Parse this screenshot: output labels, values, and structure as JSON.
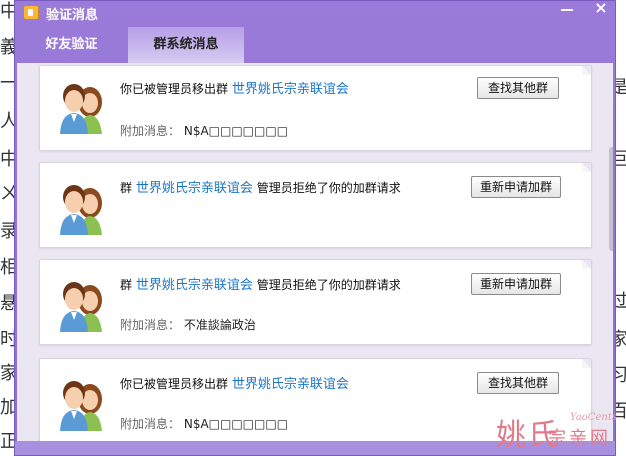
{
  "background": {
    "left_chars": [
      "中",
      "義",
      "一",
      "人",
      "中",
      "ㄨ",
      "录",
      "相",
      "悬",
      "时",
      "家",
      "加",
      "正"
    ],
    "right_chars": [
      "、",
      "是",
      "巨",
      "、",
      "过",
      "家",
      "习",
      "百"
    ]
  },
  "window": {
    "title": "验证消息",
    "close_label": "×"
  },
  "tabs": [
    {
      "label": "好友验证",
      "active": false
    },
    {
      "label": "群系统消息",
      "active": true
    }
  ],
  "messages": [
    {
      "prefix": "你已被管理员移出群",
      "group": "世界姚氏宗亲联谊会",
      "suffix": "",
      "extra_label": "附加消息：",
      "extra_value": "N$A□□□□□□□",
      "action": "查找其他群"
    },
    {
      "prefix": "群",
      "group": "世界姚氏宗亲联谊会",
      "suffix": "管理员拒绝了你的加群请求",
      "extra_label": "",
      "extra_value": "",
      "action": "重新申请加群"
    },
    {
      "prefix": "群",
      "group": "世界姚氏宗亲联谊会",
      "suffix": "管理员拒绝了你的加群请求",
      "extra_label": "附加消息：",
      "extra_value": "不准談論政治",
      "action": "重新申请加群"
    },
    {
      "prefix": "你已被管理员移出群",
      "group": "世界姚氏宗亲联谊会",
      "suffix": "",
      "extra_label": "附加消息：",
      "extra_value": "N$A□□□□□□□",
      "action": "查找其他群"
    }
  ],
  "watermark": {
    "main": "姚氏",
    "sub": "宗亲网",
    "url": "YaoCents"
  },
  "colors": {
    "titlebar": "#9a7bd9",
    "link": "#1a75c9",
    "watermark": "#e07a8a"
  }
}
